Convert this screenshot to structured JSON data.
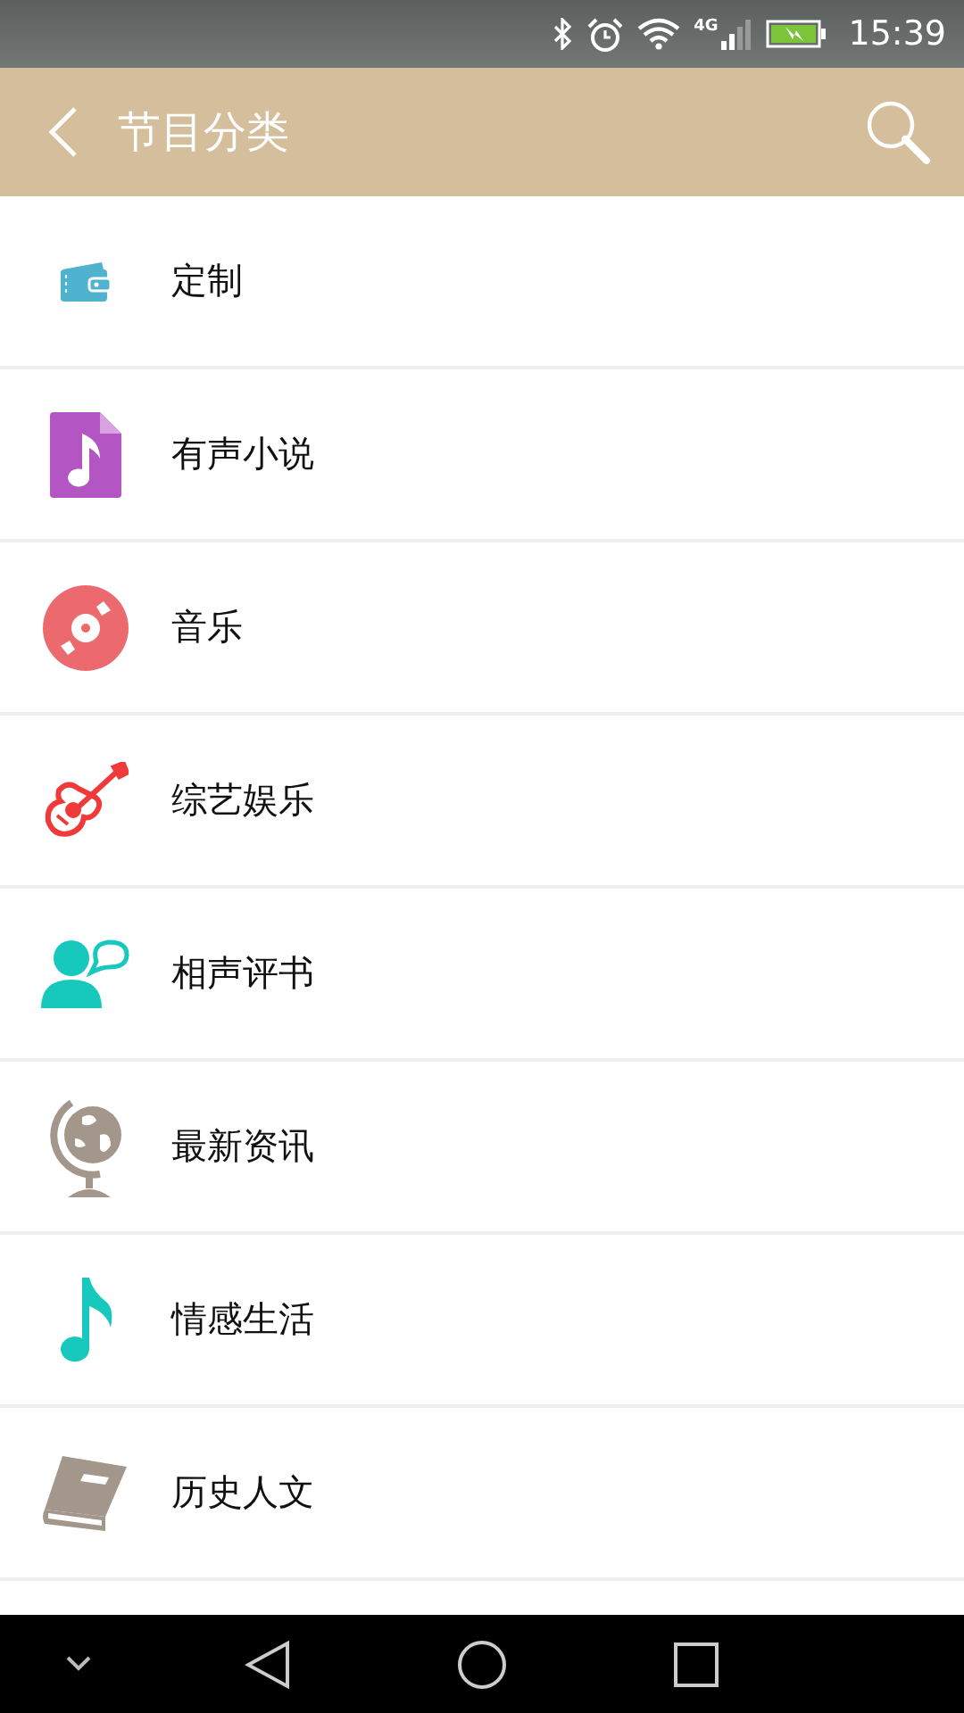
{
  "status_bar": {
    "network": "4G",
    "time": "15:39"
  },
  "app_bar": {
    "title": "节目分类"
  },
  "categories": [
    {
      "label": "定制",
      "kind": "wallet"
    },
    {
      "label": "有声小说",
      "kind": "audiofile"
    },
    {
      "label": "音乐",
      "kind": "disc"
    },
    {
      "label": "综艺娱乐",
      "kind": "guitar"
    },
    {
      "label": "相声评书",
      "kind": "speaker"
    },
    {
      "label": "最新资讯",
      "kind": "globe"
    },
    {
      "label": "情感生活",
      "kind": "note"
    },
    {
      "label": "历史人文",
      "kind": "book"
    }
  ]
}
